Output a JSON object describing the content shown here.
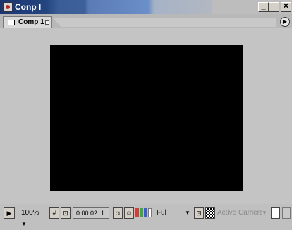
{
  "window": {
    "title": "Conp l",
    "min_label": "_",
    "max_label": "□",
    "close_label": "✕"
  },
  "tab": {
    "label": "Comp 1"
  },
  "viewer": {
    "canvas_color": "#000000"
  },
  "bottombar": {
    "zoom": "100%",
    "timecode": "0:00 02: 1",
    "resolution": "Ful",
    "camera": "Active Camera"
  },
  "icons": {
    "app": "comp-window-icon",
    "tab": "composition-icon",
    "menu": "panel-menu-arrow-icon",
    "safe_zones": "safe-zones-icon",
    "grid": "grid-icon",
    "snapshot": "snapshot-icon",
    "show_channel": "show-channel-icon",
    "region": "region-of-interest-icon",
    "transparency": "transparency-grid-icon",
    "layout": "view-layout-icon"
  }
}
